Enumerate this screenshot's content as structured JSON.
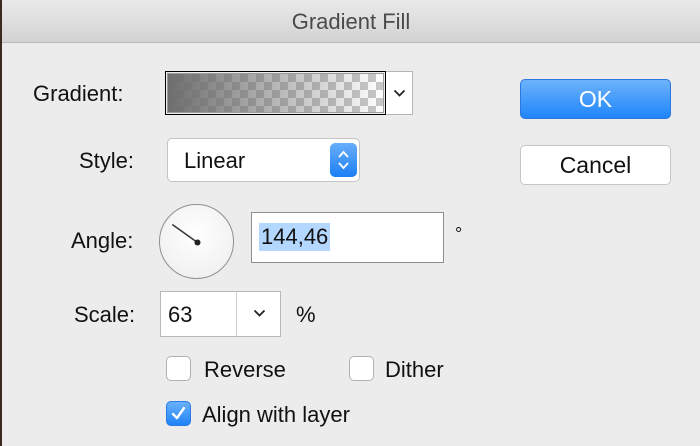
{
  "window": {
    "title": "Gradient Fill"
  },
  "gradient": {
    "label": "Gradient:",
    "swatch": "transparent-checker-gradient",
    "from_color": "#6e6e6e",
    "to_color": "transparent",
    "dropdown_icon": "chevron-down-icon"
  },
  "buttons": {
    "ok_label": "OK",
    "cancel_label": "Cancel"
  },
  "style": {
    "label": "Style:",
    "value": "Linear",
    "stepper_icon": "up-down-stepper-icon"
  },
  "angle": {
    "label": "Angle:",
    "value": "144,46",
    "degrees": 144.46,
    "unit": "°"
  },
  "scale": {
    "label": "Scale:",
    "value": "63",
    "unit": "%"
  },
  "options": {
    "reverse": {
      "label": "Reverse",
      "checked": false
    },
    "dither": {
      "label": "Dither",
      "checked": false
    },
    "align": {
      "label": "Align with layer",
      "checked": true
    }
  },
  "colors": {
    "accent": "#1f84f7",
    "selection": "#b3d7ff",
    "background": "#ececec"
  }
}
